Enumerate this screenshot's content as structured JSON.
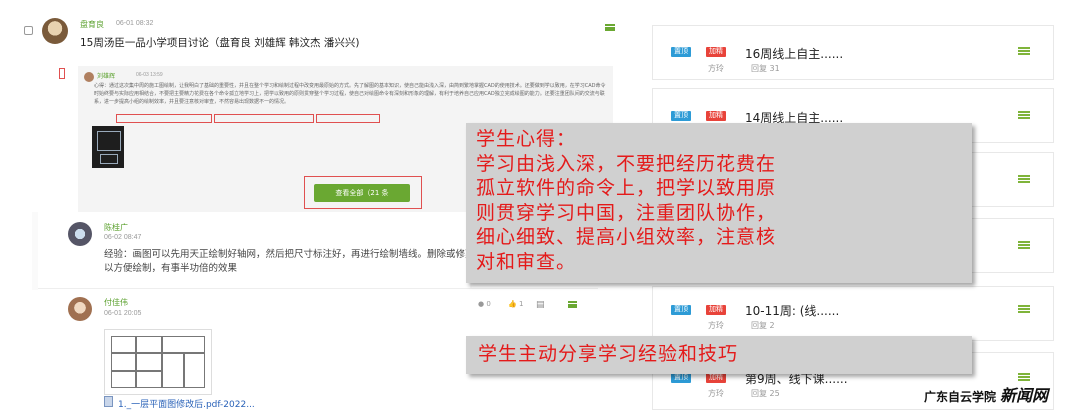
{
  "post": {
    "author": "盘育良",
    "time": "06-01 08:32",
    "title": "15周汤臣一品小学项目讨论（盘育良 刘雄辉 韩汶杰 潘兴兴)",
    "reply": {
      "author": "刘雄辉",
      "time": "06-03 13:59",
      "text": "心得：通过这次集中周的施工图绘制，让我明白了基础的重要性，并且在整个学习和绘制过程中改变用最原始的方式。先了解图的基本知识，使自己能由浅入深，由简到繁地掌握CAD的使用技术。还要做到学以致用，在学习CAD命令时始终要与实际应用相结合，不要把主要精力花费在各个命令孤立地学习上，把学以致用的原则贯穿整个学习过程，使自己对绘图命令有深刻和形象的理解，有利于培养自己应用CAD独立完成绘图的能力。还要注重团队间的交流与联系，进一步提高小组的绘制效率，并且要注意核对审查，不然容易出现数据不一的情况。",
      "hl1": "进一步提高小组的绘制效率",
      "hl2": "并且要注意核对审查",
      "view_all": "查看全部（21 条"
    }
  },
  "comment1": {
    "author": "陈桂广",
    "time": "06-02 08:47",
    "text": "经验：画图可以先用天正绘制好轴网，然后把尺寸标注好，再进行绘制墙线。删除或修剪等，可以方便绘制，有事半功倍的效果"
  },
  "comment2": {
    "author": "付佳伟",
    "time": "06-01 20:05",
    "views": "0",
    "likes": "1",
    "attachment": "1._一层平面图修改后.pdf-2022..."
  },
  "topics": [
    {
      "badge_top": "置顶",
      "badge_hot": "加精",
      "title": "16周线上自主......",
      "author": "方玲",
      "replies": "回复 31"
    },
    {
      "badge_top": "置顶",
      "badge_hot": "加精",
      "title": "14周线上自主......",
      "author": "方玲",
      "replies": "回复 ..."
    },
    {
      "badge_top": "置顶",
      "badge_hot": "加精",
      "title": "10-11周:  (线......",
      "author": "方玲",
      "replies": "回复 2"
    },
    {
      "badge_top": "置顶",
      "badge_hot": "加精",
      "title": "第9周、线下课......",
      "author": "方玲",
      "replies": "回复 25"
    }
  ],
  "overlay_main": {
    "line1": "学生心得：",
    "line2": "学习由浅入深，不要把经历花费在",
    "line3": "孤立软件的命令上，把学以致用原",
    "line4": "则贯穿学习中国，注重团队协作，",
    "line5": "细心细致、提高小组效率，注意核",
    "line6": "对和审查。"
  },
  "overlay_caption": "学生主动分享学习经验和技巧",
  "watermark": {
    "channel": "广东自云学院",
    "brand": "新闻网"
  },
  "colors": {
    "accent_green": "#6aa832",
    "badge_blue": "#2d9bd6",
    "badge_red": "#e8433a",
    "overlay_text_red": "#e41a1a"
  }
}
